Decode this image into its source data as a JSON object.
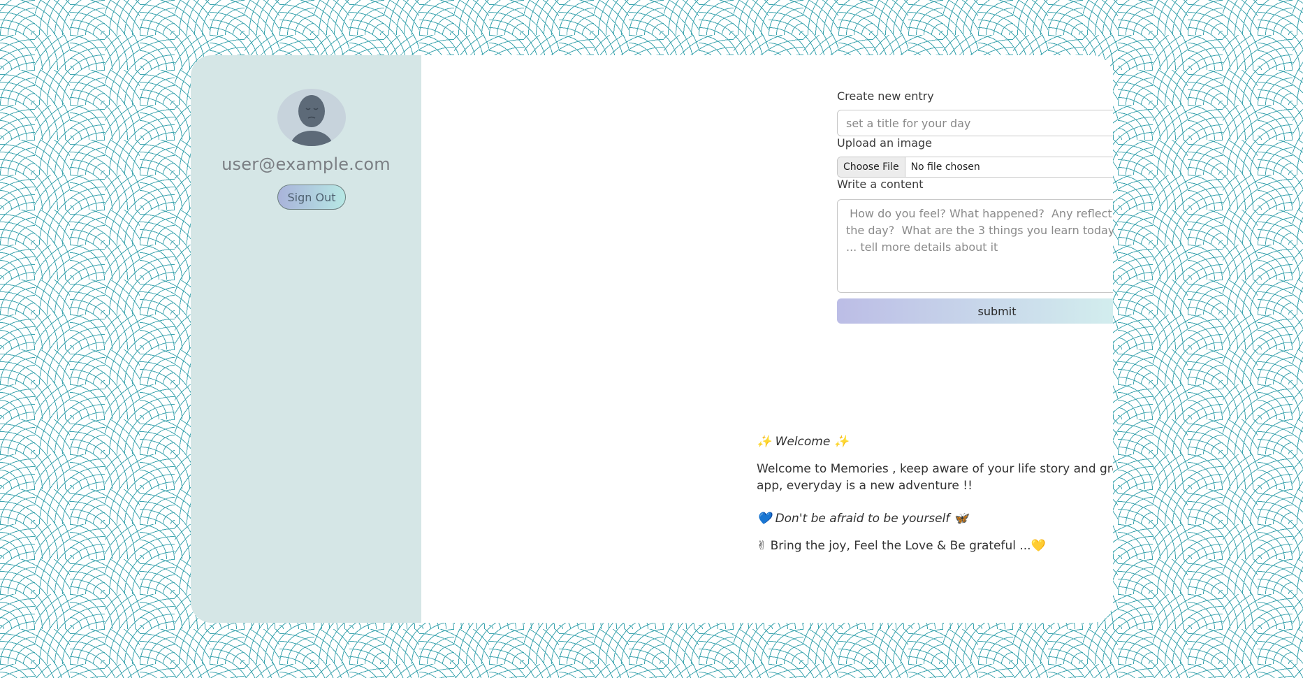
{
  "user": {
    "email": "user@example.com",
    "signout_label": "Sign Out"
  },
  "form": {
    "create_label": "Create new entry",
    "title_placeholder": "set a title for your day",
    "upload_label": "Upload an image",
    "choose_file_label": "Choose File",
    "file_status": "No file chosen",
    "content_label": "Write a content",
    "content_placeholder": " How do you feel? What happened?  Any reflection of the day?  What are the 3 things you learn today? etc ... tell more details about it",
    "submit_label": "submit"
  },
  "entries": [
    {
      "title": "✨ Welcome ✨",
      "body": "Welcome to Memories , keep aware of your life story and growth with this app, everyday is a new adventure !!"
    },
    {
      "title": "💙 Don't be afraid to be yourself 🦋",
      "body": "✌ Bring the joy, Feel the Love & Be grateful ...💛"
    }
  ],
  "icons": {
    "image": "image-icon",
    "edit": "edit-icon",
    "delete": "trash-icon"
  },
  "colors": {
    "sidebar": "#d5e6e6",
    "image_icon": "#a9b4e6",
    "edit_icon": "#8fd8c8",
    "delete_icon": "#f0a08c"
  }
}
